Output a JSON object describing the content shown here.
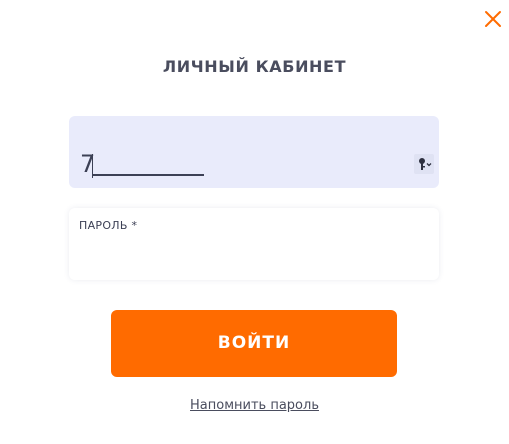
{
  "modal": {
    "title": "ЛИЧНЫЙ КАБИНЕТ",
    "close_icon": "close-icon"
  },
  "phone_field": {
    "value": "7",
    "background": "#e9ebfb",
    "icon": "key-icon"
  },
  "password_field": {
    "label": "ПАРОЛЬ *",
    "value": ""
  },
  "login_button": {
    "label": "ВОЙТИ",
    "color": "#ff6b00"
  },
  "remind_link": {
    "label": "Напомнить пароль"
  },
  "colors": {
    "accent": "#ff6b00",
    "text": "#4a4d5e"
  }
}
